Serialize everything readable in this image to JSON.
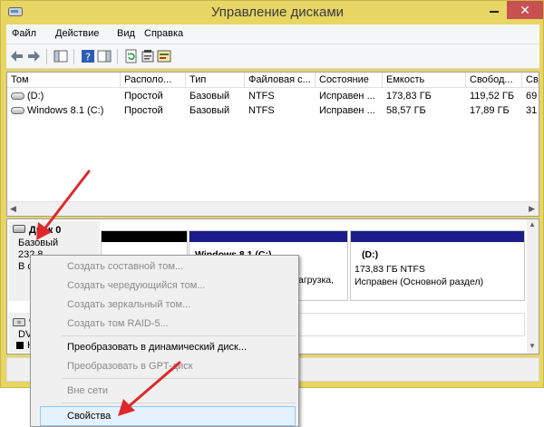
{
  "window": {
    "title": "Управление дисками",
    "close_glyph": "✕"
  },
  "menu": [
    "Файл",
    "Действие",
    "Вид",
    "Справка"
  ],
  "toolbar_icons": [
    "back-arrow-icon",
    "forward-arrow-icon",
    "console-tree-icon",
    "help-icon",
    "action-pane-icon",
    "refresh-icon",
    "properties-icon",
    "settings-icon"
  ],
  "volume_list": {
    "columns": [
      "Том",
      "Располо...",
      "Тип",
      "Файловая с...",
      "Состояние",
      "Емкость",
      "Свобод...",
      "Св"
    ],
    "rows": [
      {
        "name": "(D:)",
        "layout": "Простой",
        "type": "Базовый",
        "fs": "NTFS",
        "status": "Исправен ...",
        "capacity": "173,83 ГБ",
        "free": "119,52 ГБ",
        "pct": "69"
      },
      {
        "name": "Windows 8.1 (C:)",
        "layout": "Простой",
        "type": "Базовый",
        "fs": "NTFS",
        "status": "Исправен ...",
        "capacity": "58,57 ГБ",
        "free": "17,89 ГБ",
        "pct": "31"
      }
    ]
  },
  "disks": {
    "disk0": {
      "name": "Диск 0",
      "type": "Базовый",
      "size": "232,8",
      "status": "В сет"
    },
    "partitions": [
      {
        "title": "",
        "line1": "",
        "line2": ""
      },
      {
        "title": "Windows 8.1 (C:)",
        "line1": "",
        "line2": "агрузка, "
      },
      {
        "title": "(D:)",
        "line1": "173,83 ГБ NTFS",
        "line2": "Исправен (Основной раздел)"
      }
    ],
    "cdrom": {
      "name": "С",
      "type": "DVD",
      "status": "Не"
    }
  },
  "context_menu": {
    "items": [
      {
        "label": "Создать составной том...",
        "enabled": false
      },
      {
        "label": "Создать чередующийся том...",
        "enabled": false
      },
      {
        "label": "Создать зеркальный том...",
        "enabled": false
      },
      {
        "label": "Создать том RAID-5...",
        "enabled": false
      },
      {
        "label": "Преобразовать в динамический диск...",
        "enabled": true
      },
      {
        "label": "Преобразовать в GPT-диск",
        "enabled": false
      },
      {
        "label": "Вне сети",
        "enabled": false
      },
      {
        "label": "Свойства",
        "enabled": true
      }
    ]
  },
  "colors": {
    "window_frame": "#e7d564",
    "primary_partition_bar": "#1c1c8a",
    "unallocated_bar": "#000000",
    "annotation_arrow": "#e0282a",
    "close_button": "#c75050",
    "menu_hover": "#e5f1fb"
  }
}
